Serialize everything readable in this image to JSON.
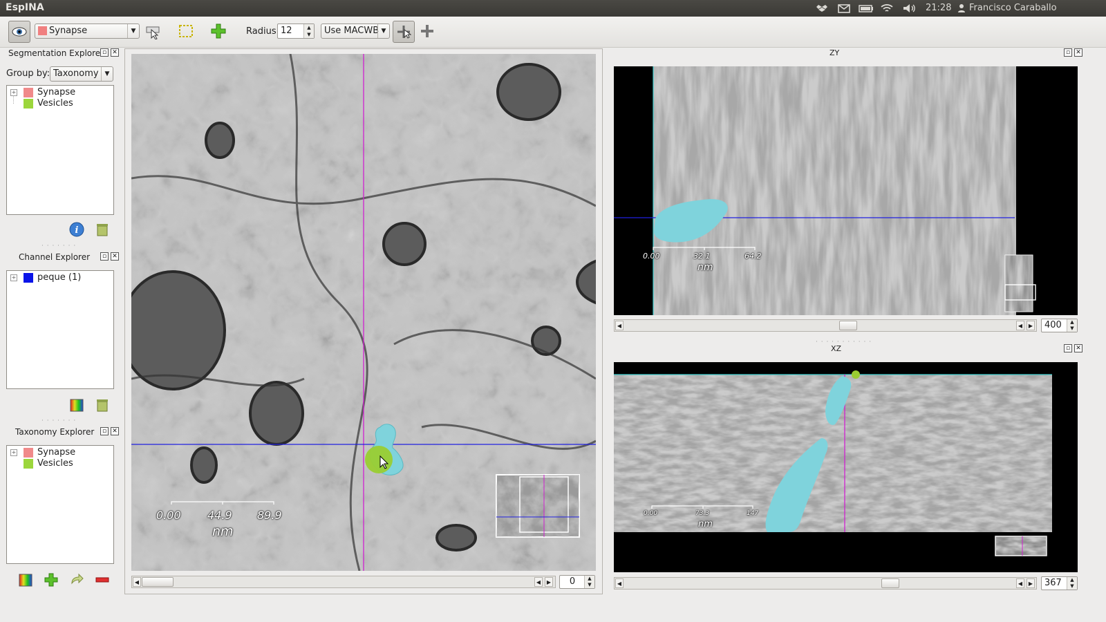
{
  "system_bar": {
    "app_name": "EspINA",
    "time": "21:28",
    "user": "Francisco Caraballo",
    "icons": [
      "dropbox-icon",
      "mail-icon",
      "battery-icon",
      "wifi-icon",
      "volume-icon",
      "user-icon"
    ]
  },
  "toolbar": {
    "segmentation_select": "Synapse",
    "segmentation_color": "#f08080",
    "radius_label": "Radius",
    "radius_value": "12",
    "filter_select": "Use MACWB",
    "icons": [
      "eye-icon",
      "pointer-brush-icon",
      "selection-rect-icon",
      "add-segmentation-icon",
      "seed-tool-icon",
      "crosshair-icon"
    ]
  },
  "segmentation_explorer": {
    "title": "Segmentation Explorer",
    "group_by_label": "Group by:",
    "group_by_value": "Taxonomy",
    "items": [
      {
        "label": "Synapse",
        "color": "#f08a8a"
      },
      {
        "label": "Vesicles",
        "color": "#9cd63c"
      }
    ]
  },
  "channel_explorer": {
    "title": "Channel Explorer",
    "items": [
      {
        "label": "peque (1)",
        "color": "#0a14e8"
      }
    ]
  },
  "taxonomy_explorer": {
    "title": "Taxonomy Explorer",
    "items": [
      {
        "label": "Synapse",
        "color": "#f08a8a"
      },
      {
        "label": "Vesicles",
        "color": "#9cd63c"
      }
    ]
  },
  "views": {
    "xy": {
      "scale_labels": [
        "0.00",
        "44.9",
        "89.9"
      ],
      "scale_unit": "nm",
      "slice_value": "0"
    },
    "zy": {
      "title": "ZY",
      "scale_labels": [
        "0.00",
        "32.1",
        "64.2"
      ],
      "scale_unit": "nm",
      "slice_value": "400"
    },
    "xz": {
      "title": "XZ",
      "scale_labels": [
        "0.00",
        "73.3",
        "147"
      ],
      "scale_unit": "nm",
      "slice_value": "367"
    }
  },
  "colors": {
    "segmentation_overlay": "#7fd3dc",
    "vertical_crosshair": "#d020d0",
    "horizontal_crosshair": "#2020e0",
    "brush_cursor": "#9acd32"
  }
}
